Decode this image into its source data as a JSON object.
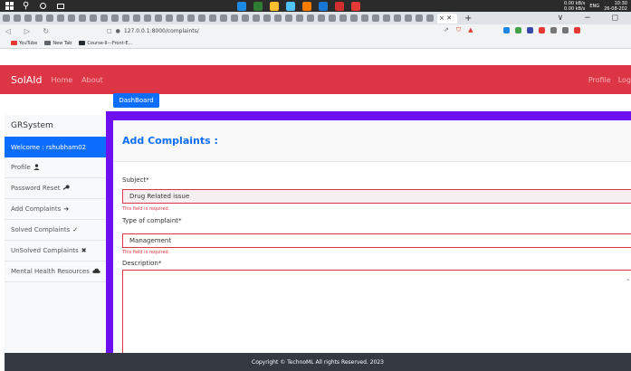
{
  "taskbar": {
    "search_glyph": "⚲",
    "app_colors": [
      "#1e88e5",
      "#2e7d32",
      "#fbc02d",
      "#4fc3f7",
      "#f57c00",
      "#1976d2",
      "#d32f2f",
      "#e53935"
    ],
    "tray": {
      "network_top": "0.00 kB/s",
      "network_bottom": "0.00 kB/s",
      "language": "ENG",
      "time": "10:30",
      "date": "26-08-202"
    }
  },
  "browser": {
    "tab_label": "× ✕",
    "new_tab_glyph": "+",
    "window_controls": "∨ − ◻",
    "url": "127.0.0.1:8000/complaints/",
    "extension_colors": [
      "#1e88e5",
      "#43a047",
      "#3949ab",
      "#e53935",
      "#757575",
      "#757575",
      "#e53935"
    ],
    "bookmarks": [
      {
        "label": "YouTube",
        "color": "#e53935"
      },
      {
        "label": "New Tab",
        "color": "#5f6368"
      },
      {
        "label": "Course-II---Front-E...",
        "color": "#24292f"
      }
    ]
  },
  "navbar": {
    "brand": "SolAId",
    "links": [
      "Home",
      "About"
    ],
    "right_links": [
      "Profile",
      "Log"
    ],
    "color": "#dc3545"
  },
  "sidebar": {
    "title": "GRSystem",
    "items": [
      {
        "label": "Welcome : rshubham02",
        "icon": ""
      },
      {
        "label": "Profile",
        "icon": "user-icon"
      },
      {
        "label": "Password Reset",
        "icon": "key-icon"
      },
      {
        "label": "Add Complaints",
        "icon": "arrow-right-icon"
      },
      {
        "label": "Solved Complaints",
        "icon": "check-icon"
      },
      {
        "label": "UnSolved Complaints",
        "icon": "cross-icon"
      },
      {
        "label": "Mental Health Resources",
        "icon": "cloud-icon"
      }
    ]
  },
  "dashboard_button": "DashBoard",
  "form": {
    "title": "Add Complaints :",
    "subject": {
      "label": "Subject*",
      "value": "Drug Related issue",
      "error": "This field is required."
    },
    "type": {
      "label": "Type of complaint*",
      "value": "Management",
      "error": "This field is required."
    },
    "description": {
      "label": "Description*"
    }
  },
  "footer": "Copyright © TechnoML All rights Reserved. 2023",
  "colors": {
    "primary": "#0d6efd",
    "purple_panel": "#6f10f4",
    "footer": "#343a40"
  }
}
